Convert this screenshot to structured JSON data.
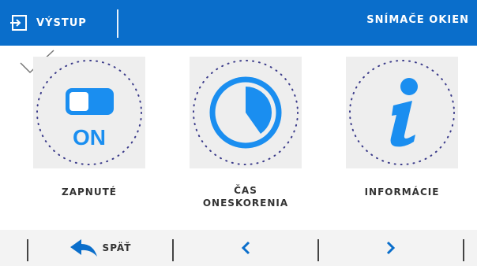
{
  "colors": {
    "accent": "#0a6ecb",
    "tile_bg": "#eeeeee",
    "text": "#333333"
  },
  "header": {
    "exit_label": "VÝSTUP",
    "exit_icon": "exit-icon",
    "title": "SNÍMAČE OKIEN"
  },
  "status": {
    "check_icon": "check-icon"
  },
  "tiles": [
    {
      "icon": "toggle-on-icon",
      "icon_text": "ON",
      "label": "ZAPNUTÉ"
    },
    {
      "icon": "clock-icon",
      "label_line1": "ČAS",
      "label_line2": "ONESKORENIA"
    },
    {
      "icon": "info-icon",
      "label": "INFORMÁCIE"
    }
  ],
  "footer": {
    "back_label": "SPÄŤ",
    "back_icon": "back-arrow-icon",
    "prev_icon": "chevron-left-icon",
    "next_icon": "chevron-right-icon"
  }
}
